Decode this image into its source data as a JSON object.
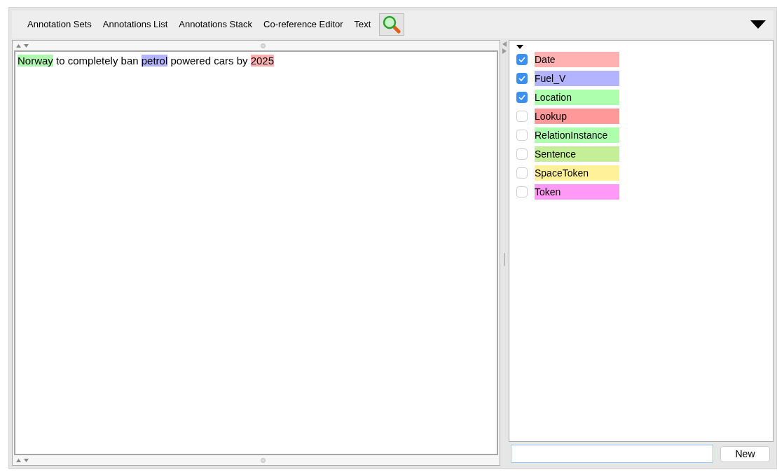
{
  "tabs": [
    {
      "label": "Annotation Sets"
    },
    {
      "label": "Annotations List"
    },
    {
      "label": "Annotations Stack"
    },
    {
      "label": "Co-reference Editor"
    },
    {
      "label": "Text"
    }
  ],
  "document": {
    "segments": [
      {
        "text": "Norway",
        "color": "#aff7af"
      },
      {
        "text": " to completely ban "
      },
      {
        "text": "petrol",
        "color": "#b3b3ff"
      },
      {
        "text": " powered cars by "
      },
      {
        "text": "2025",
        "color": "#ffb0b0"
      }
    ]
  },
  "annotation_types": [
    {
      "label": "Date",
      "checked": true,
      "color": "#ffb0b0"
    },
    {
      "label": "Fuel_V",
      "checked": true,
      "color": "#b3b3ff"
    },
    {
      "label": "Location",
      "checked": true,
      "color": "#adffad"
    },
    {
      "label": "Lookup",
      "checked": false,
      "color": "#ff9999"
    },
    {
      "label": "RelationInstance",
      "checked": false,
      "color": "#adffad"
    },
    {
      "label": "Sentence",
      "checked": false,
      "color": "#c5ef97"
    },
    {
      "label": "SpaceToken",
      "checked": false,
      "color": "#fff09a"
    },
    {
      "label": "Token",
      "checked": false,
      "color": "#ff99f5"
    }
  ],
  "new_button": "New"
}
